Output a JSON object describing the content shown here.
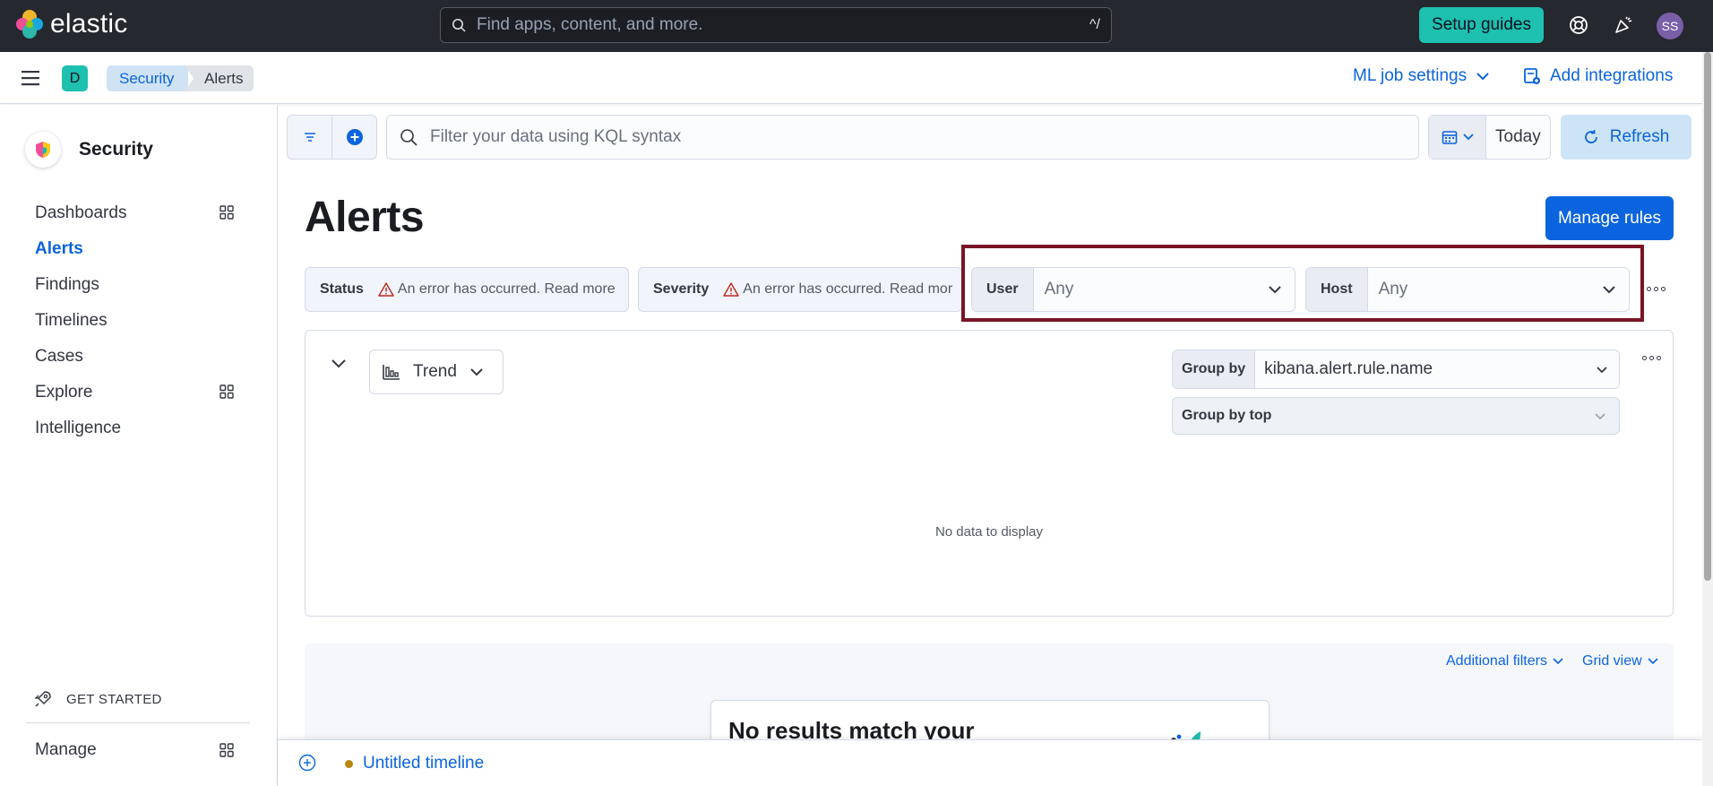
{
  "header": {
    "brand": "elastic",
    "search_placeholder": "Find apps, content, and more.",
    "search_shortcut": "^/",
    "setup_guides": "Setup guides",
    "avatar_initials": "SS"
  },
  "subbar": {
    "space_initial": "D",
    "breadcrumbs": [
      "Security",
      "Alerts"
    ],
    "ml_job_settings": "ML job settings",
    "add_integrations": "Add integrations"
  },
  "sidebar": {
    "title": "Security",
    "items": [
      {
        "label": "Dashboards",
        "has_grid": true,
        "active": false
      },
      {
        "label": "Alerts",
        "has_grid": false,
        "active": true
      },
      {
        "label": "Findings",
        "has_grid": false,
        "active": false
      },
      {
        "label": "Timelines",
        "has_grid": false,
        "active": false
      },
      {
        "label": "Cases",
        "has_grid": false,
        "active": false
      },
      {
        "label": "Explore",
        "has_grid": true,
        "active": false
      },
      {
        "label": "Intelligence",
        "has_grid": false,
        "active": false
      }
    ],
    "get_started": "GET STARTED",
    "manage": "Manage"
  },
  "query_bar": {
    "kql_placeholder": "Filter your data using KQL syntax",
    "date_label": "Today",
    "refresh": "Refresh"
  },
  "page": {
    "title": "Alerts",
    "manage_rules": "Manage rules"
  },
  "filters": {
    "status_label": "Status",
    "status_error": "An error has occurred. Read more",
    "severity_label": "Severity",
    "severity_error": "An error has occurred. Read mor",
    "user_label": "User",
    "user_value": "Any",
    "host_label": "Host",
    "host_value": "Any"
  },
  "trend": {
    "view_label": "Trend",
    "group_by_label": "Group by",
    "group_by_value": "kibana.alert.rule.name",
    "group_by_top_label": "Group by top",
    "group_by_top_value": "",
    "no_data": "No data to display"
  },
  "results": {
    "additional_filters": "Additional filters",
    "grid_view": "Grid view",
    "empty_title": "No results match your"
  },
  "timeline": {
    "title": "Untitled timeline"
  },
  "colors": {
    "header_bg": "#25282f",
    "accent_teal": "#1ec0b0",
    "link_blue": "#0b64dd",
    "highlight_border": "#7a1526",
    "error_red": "#bd271e"
  }
}
